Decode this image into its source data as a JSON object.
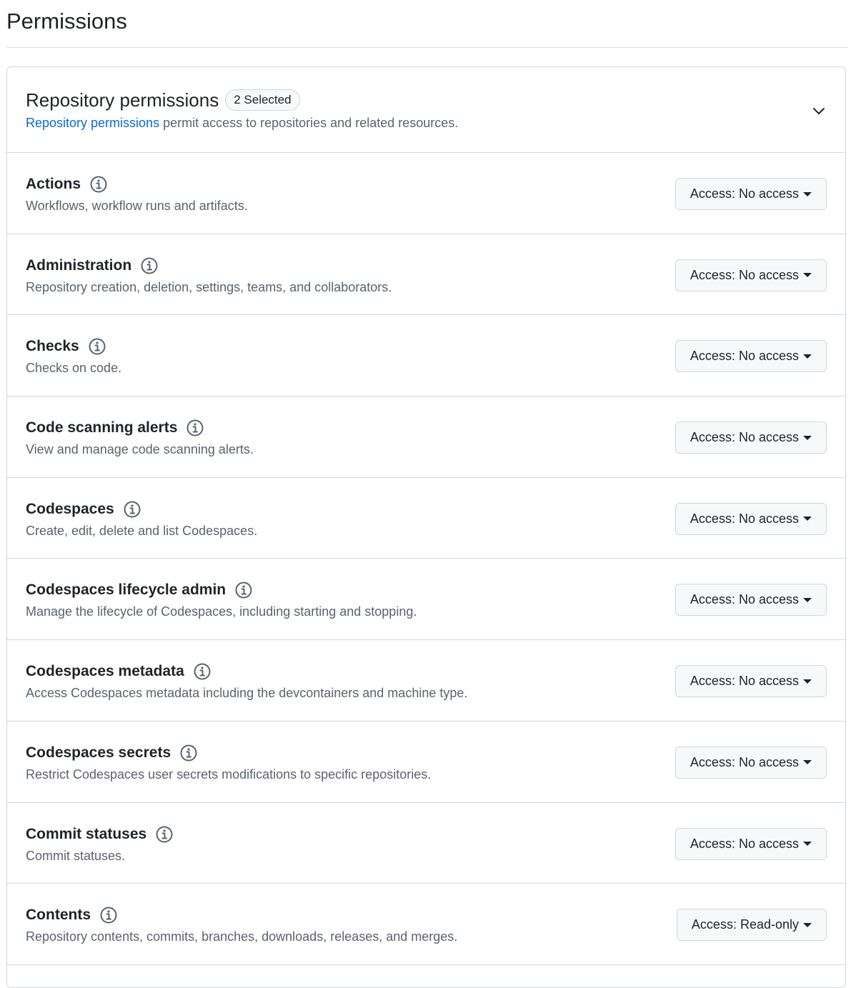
{
  "page": {
    "title": "Permissions"
  },
  "section": {
    "title": "Repository permissions",
    "badge": "2 Selected",
    "desc_link": "Repository permissions",
    "desc_rest": " permit access to repositories and related resources.",
    "expand_icon": "chevron-down-icon"
  },
  "access_prefix": "Access:",
  "permissions": [
    {
      "name": "Actions",
      "desc": "Workflows, workflow runs and artifacts.",
      "access": "No access"
    },
    {
      "name": "Administration",
      "desc": "Repository creation, deletion, settings, teams, and collaborators.",
      "access": "No access"
    },
    {
      "name": "Checks",
      "desc": "Checks on code.",
      "access": "No access"
    },
    {
      "name": "Code scanning alerts",
      "desc": "View and manage code scanning alerts.",
      "access": "No access"
    },
    {
      "name": "Codespaces",
      "desc": "Create, edit, delete and list Codespaces.",
      "access": "No access"
    },
    {
      "name": "Codespaces lifecycle admin",
      "desc": "Manage the lifecycle of Codespaces, including starting and stopping.",
      "access": "No access"
    },
    {
      "name": "Codespaces metadata",
      "desc": "Access Codespaces metadata including the devcontainers and machine type.",
      "access": "No access"
    },
    {
      "name": "Codespaces secrets",
      "desc": "Restrict Codespaces user secrets modifications to specific repositories.",
      "access": "No access"
    },
    {
      "name": "Commit statuses",
      "desc": "Commit statuses.",
      "access": "No access"
    },
    {
      "name": "Contents",
      "desc": "Repository contents, commits, branches, downloads, releases, and merges.",
      "access": "Read-only"
    }
  ],
  "colors": {
    "link": "#0969da",
    "border": "#d0d7de",
    "muted_text": "#59636e",
    "button_bg": "#f6f8fa"
  }
}
